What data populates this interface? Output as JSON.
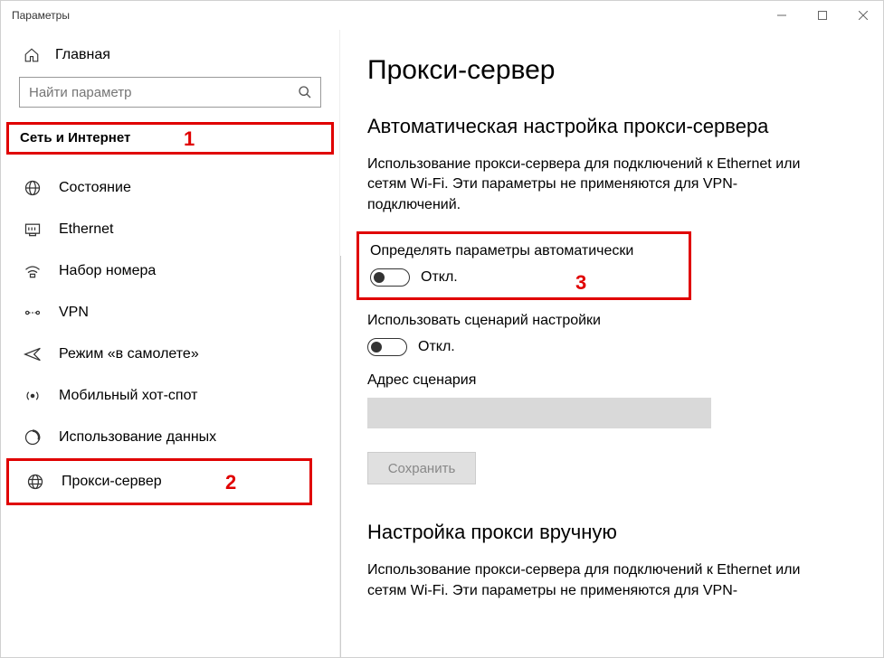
{
  "window": {
    "title": "Параметры"
  },
  "sidebar": {
    "home": "Главная",
    "search_placeholder": "Найти параметр",
    "category": "Сеть и Интернет",
    "items": [
      {
        "label": "Состояние"
      },
      {
        "label": "Ethernet"
      },
      {
        "label": "Набор номера"
      },
      {
        "label": "VPN"
      },
      {
        "label": "Режим «в самолете»"
      },
      {
        "label": "Мобильный хот-спот"
      },
      {
        "label": "Использование данных"
      },
      {
        "label": "Прокси-сервер"
      }
    ]
  },
  "content": {
    "title": "Прокси-сервер",
    "auto_section_title": "Автоматическая настройка прокси-сервера",
    "auto_desc": "Использование прокси-сервера для подключений к Ethernet или сетям Wi-Fi. Эти параметры не применяются для VPN-подключений.",
    "auto_detect_label": "Определять параметры автоматически",
    "auto_detect_state": "Откл.",
    "use_script_label": "Использовать сценарий настройки",
    "use_script_state": "Откл.",
    "script_address_label": "Адрес сценария",
    "save_label": "Сохранить",
    "manual_section_title": "Настройка прокси вручную",
    "manual_desc": "Использование прокси-сервера для подключений к Ethernet или сетям Wi-Fi. Эти параметры не применяются для VPN-"
  },
  "annotations": {
    "a1": "1",
    "a2": "2",
    "a3": "3"
  }
}
